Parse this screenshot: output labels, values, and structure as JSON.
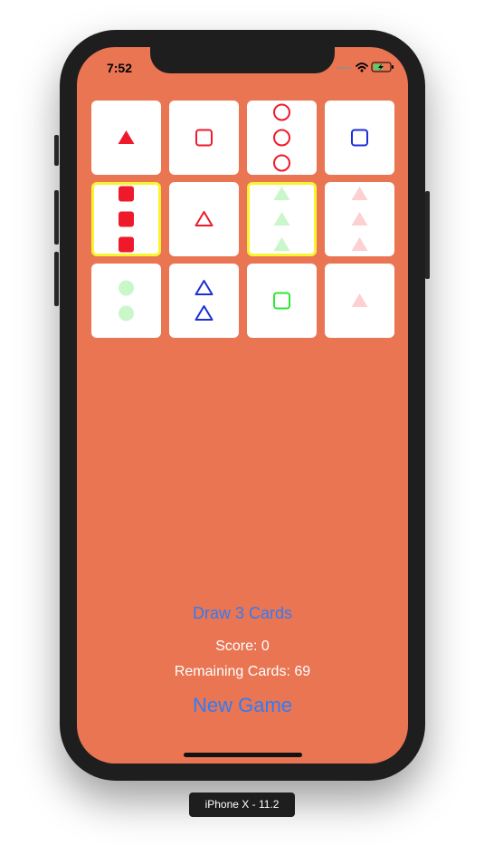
{
  "status_bar": {
    "time": "7:52"
  },
  "cards": [
    {
      "count": 1,
      "shape": "triangle",
      "fill": "solid",
      "color": "#ee1a2b",
      "selected": false
    },
    {
      "count": 1,
      "shape": "square",
      "fill": "outline",
      "color": "#ee1a2b",
      "selected": false
    },
    {
      "count": 3,
      "shape": "circle",
      "fill": "outline",
      "color": "#ee1a2b",
      "selected": false
    },
    {
      "count": 1,
      "shape": "square",
      "fill": "outline",
      "color": "#1b2fd6",
      "selected": false
    },
    {
      "count": 3,
      "shape": "square",
      "fill": "solid",
      "color": "#ee1a2b",
      "selected": true
    },
    {
      "count": 1,
      "shape": "triangle",
      "fill": "outline",
      "color": "#ee1a2b",
      "selected": false
    },
    {
      "count": 3,
      "shape": "triangle",
      "fill": "shaded",
      "color": "#c9f7c9",
      "selected": true
    },
    {
      "count": 3,
      "shape": "triangle",
      "fill": "shaded",
      "color": "#fdd0d2",
      "selected": false
    },
    {
      "count": 2,
      "shape": "circle",
      "fill": "shaded",
      "color": "#c9f7c9",
      "selected": false
    },
    {
      "count": 2,
      "shape": "triangle",
      "fill": "outline",
      "color": "#1b2fd6",
      "selected": false
    },
    {
      "count": 1,
      "shape": "square",
      "fill": "outline",
      "color": "#2ce830",
      "selected": false
    },
    {
      "count": 1,
      "shape": "triangle",
      "fill": "shaded",
      "color": "#fdd0d2",
      "selected": false
    }
  ],
  "controls": {
    "draw_label": "Draw 3 Cards",
    "score_text": "Score: 0",
    "remaining_text": "Remaining Cards: 69",
    "new_game_label": "New Game"
  },
  "device_label": "iPhone X - 11.2",
  "colors": {
    "background": "#e97553",
    "button_text": "#2f7cf6",
    "selected_border": "#f7f432"
  }
}
